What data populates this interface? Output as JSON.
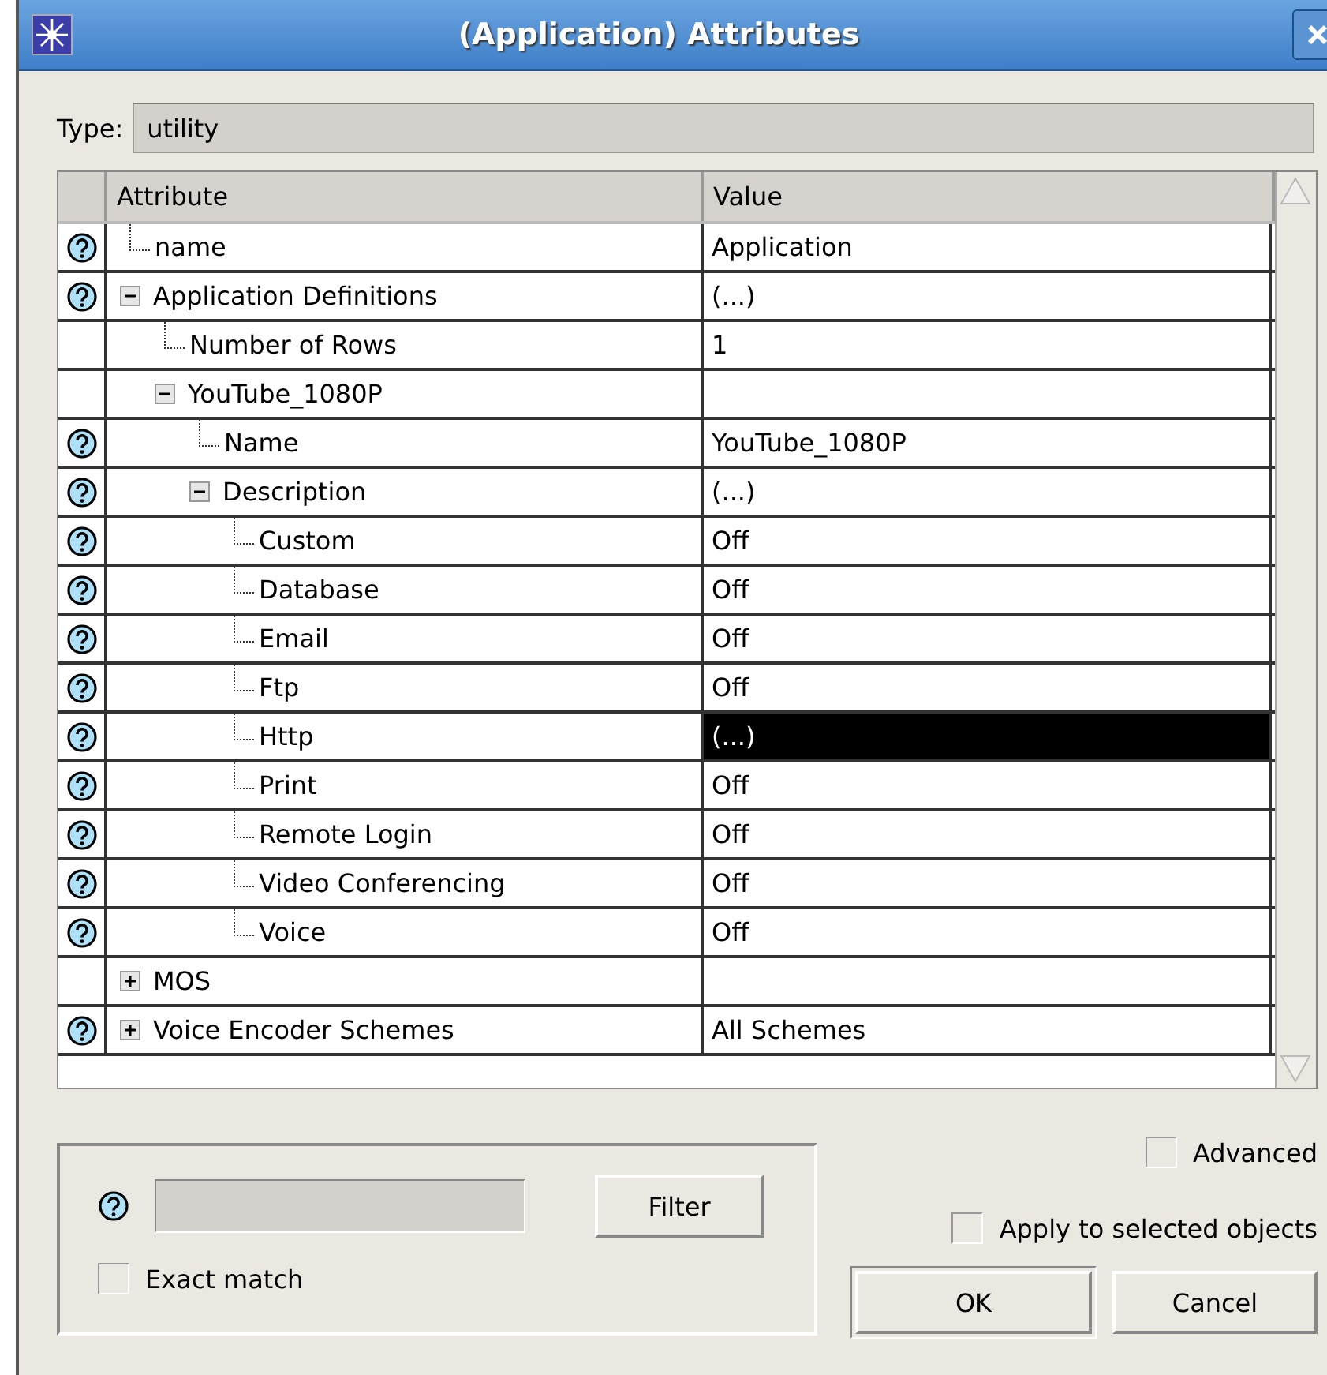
{
  "window": {
    "title": "(Application) Attributes"
  },
  "type_field": {
    "label": "Type:",
    "value": "utility"
  },
  "table": {
    "columns": [
      "Attribute",
      "Value"
    ],
    "rows": [
      {
        "name": "name",
        "value": "Application",
        "help": true,
        "selected": false
      },
      {
        "name": "Application Definitions",
        "value": "(...)",
        "help": true,
        "selected": false,
        "expanded": true,
        "children": [
          {
            "name": "Number of Rows",
            "value": "1",
            "help": false,
            "selected": false
          },
          {
            "name": "YouTube_1080P",
            "help": false,
            "selected": false,
            "expanded": true,
            "children": [
              {
                "name": "Name",
                "value": "YouTube_1080P",
                "help": true,
                "selected": false
              },
              {
                "name": "Description",
                "value": "(...)",
                "help": true,
                "selected": false,
                "expanded": true,
                "children": [
                  {
                    "name": "Custom",
                    "value": "Off",
                    "help": true,
                    "selected": false
                  },
                  {
                    "name": "Database",
                    "value": "Off",
                    "help": true,
                    "selected": false
                  },
                  {
                    "name": "Email",
                    "value": "Off",
                    "help": true,
                    "selected": false
                  },
                  {
                    "name": "Ftp",
                    "value": "Off",
                    "help": true,
                    "selected": false
                  },
                  {
                    "name": "Http",
                    "value": "(...)",
                    "help": true,
                    "selected": true
                  },
                  {
                    "name": "Print",
                    "value": "Off",
                    "help": true,
                    "selected": false
                  },
                  {
                    "name": "Remote Login",
                    "value": "Off",
                    "help": true,
                    "selected": false
                  },
                  {
                    "name": "Video Conferencing",
                    "value": "Off",
                    "help": true,
                    "selected": false
                  },
                  {
                    "name": "Voice",
                    "value": "Off",
                    "help": true,
                    "selected": false
                  }
                ]
              }
            ]
          }
        ]
      },
      {
        "name": "MOS",
        "help": false,
        "selected": false,
        "expanded": false,
        "children": []
      },
      {
        "name": "Voice Encoder Schemes",
        "value": "All Schemes",
        "help": true,
        "selected": false,
        "expanded": false,
        "children": []
      }
    ]
  },
  "filter": {
    "button": "Filter",
    "exact_match": {
      "label": "Exact match",
      "checked": false
    }
  },
  "advanced": {
    "label": "Advanced",
    "checked": false
  },
  "apply_to_selected": {
    "label": "Apply to selected objects",
    "checked": false
  },
  "buttons": [
    "OK",
    "Cancel"
  ]
}
